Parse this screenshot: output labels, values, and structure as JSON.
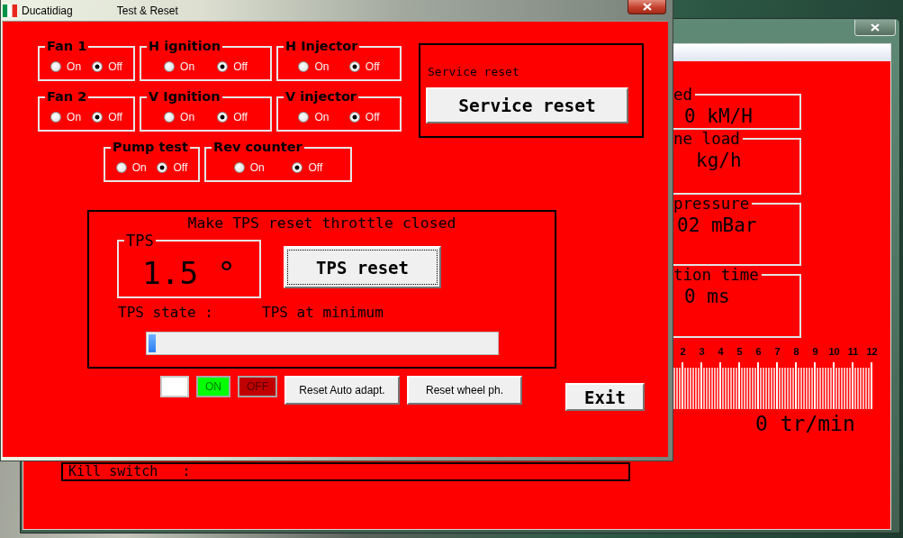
{
  "window": {
    "title": "Ducatidiag",
    "caption": "Test & Reset"
  },
  "switch_rows": [
    {
      "groups": [
        {
          "title": "Fan 1",
          "options": [
            {
              "label": "On",
              "selected": false
            },
            {
              "label": "Off",
              "selected": true
            }
          ]
        },
        {
          "title": "H ignition",
          "options": [
            {
              "label": "On",
              "selected": false
            },
            {
              "label": "Off",
              "selected": true
            }
          ]
        },
        {
          "title": "H Injector",
          "options": [
            {
              "label": "On",
              "selected": false
            },
            {
              "label": "Off",
              "selected": true
            }
          ]
        }
      ]
    },
    {
      "groups": [
        {
          "title": "Fan 2",
          "options": [
            {
              "label": "On",
              "selected": false
            },
            {
              "label": "Off",
              "selected": true
            }
          ]
        },
        {
          "title": "V Ignition",
          "options": [
            {
              "label": "On",
              "selected": false
            },
            {
              "label": "Off",
              "selected": true
            }
          ]
        },
        {
          "title": "V injector",
          "options": [
            {
              "label": "On",
              "selected": false
            },
            {
              "label": "Off",
              "selected": true
            }
          ]
        }
      ]
    },
    {
      "groups": [
        {
          "title": "Pump test",
          "options": [
            {
              "label": "On",
              "selected": false
            },
            {
              "label": "Off",
              "selected": true
            }
          ]
        },
        {
          "title": "Rev counter",
          "options": [
            {
              "label": "On",
              "selected": false
            },
            {
              "label": "Off",
              "selected": true
            }
          ]
        }
      ]
    }
  ],
  "service_reset": {
    "caption": "Service reset",
    "button": "Service reset"
  },
  "tps": {
    "instruction": "Make TPS reset throttle closed",
    "title": "TPS",
    "value": "1.5 °",
    "reset_button": {
      "label": "TPS reset",
      "focused": true
    },
    "state_label": "TPS state :",
    "state_value": "TPS at minimum",
    "level": 0.02
  },
  "lamps": [
    {
      "label": "ON",
      "color": "#00ff00"
    },
    {
      "label": "OFF",
      "color": "#c00000"
    }
  ],
  "buttons": [
    "Reset Auto adapt.",
    "Reset wheel ph."
  ],
  "exit_button": "Exit",
  "background_window": {
    "gauges": [
      {
        "title": "ed",
        "value": "0 kM/H"
      },
      {
        "title": "ne load",
        "value": "kg/h"
      },
      {
        "title": "pressure",
        "value": "02 mBar"
      },
      {
        "title": "tion time",
        "value": "0 ms"
      }
    ],
    "rpm_ticks": [
      "2",
      "3",
      "4",
      "5",
      "6",
      "7",
      "8",
      "9",
      "10",
      "11",
      "12"
    ],
    "rpm_reading": "0 tr/min",
    "kill_switch": "Kill switch   :"
  }
}
